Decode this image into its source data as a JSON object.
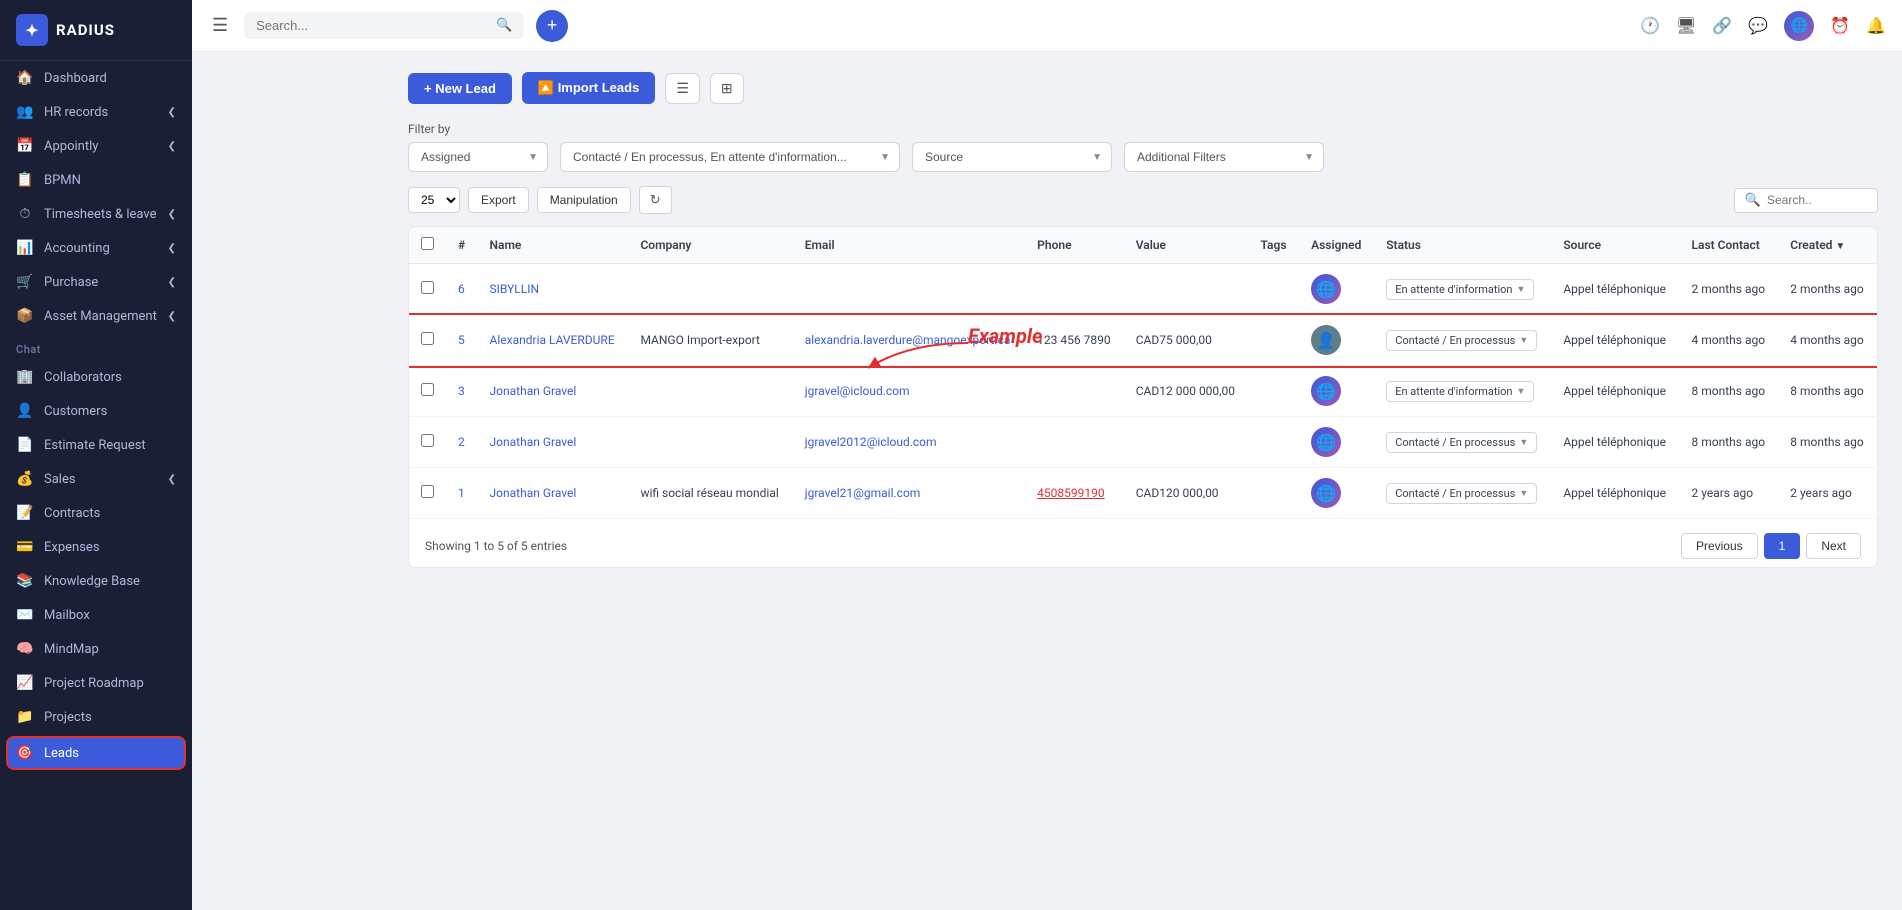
{
  "app": {
    "name": "RADIUS"
  },
  "sidebar": {
    "items": [
      {
        "id": "dashboard",
        "label": "Dashboard",
        "icon": "🏠"
      },
      {
        "id": "hr-records",
        "label": "HR records",
        "icon": "👥",
        "hasChevron": true
      },
      {
        "id": "appointly",
        "label": "Appointly",
        "icon": "📅",
        "hasChevron": true
      },
      {
        "id": "bpmn",
        "label": "BPMN",
        "icon": "📋"
      },
      {
        "id": "timesheets",
        "label": "Timesheets & leave",
        "icon": "⏱",
        "hasChevron": true
      },
      {
        "id": "accounting",
        "label": "Accounting",
        "icon": "📊",
        "hasChevron": true
      },
      {
        "id": "purchase",
        "label": "Purchase",
        "icon": "🛒",
        "hasChevron": true
      },
      {
        "id": "asset-management",
        "label": "Asset Management",
        "icon": "📦",
        "hasChevron": true
      },
      {
        "id": "chat",
        "label": "Chat",
        "isSection": true
      },
      {
        "id": "collaborators",
        "label": "Collaborators",
        "icon": "🏢"
      },
      {
        "id": "customers",
        "label": "Customers",
        "icon": "👤"
      },
      {
        "id": "estimate-request",
        "label": "Estimate Request",
        "icon": "📄"
      },
      {
        "id": "sales",
        "label": "Sales",
        "icon": "💰",
        "hasChevron": true
      },
      {
        "id": "contracts",
        "label": "Contracts",
        "icon": "📝"
      },
      {
        "id": "expenses",
        "label": "Expenses",
        "icon": "💳"
      },
      {
        "id": "knowledge-base",
        "label": "Knowledge Base",
        "icon": "📚"
      },
      {
        "id": "mailbox",
        "label": "Mailbox",
        "icon": "✉️"
      },
      {
        "id": "mindmap",
        "label": "MindMap",
        "icon": "🧠"
      },
      {
        "id": "project-roadmap",
        "label": "Project Roadmap",
        "icon": "📈"
      },
      {
        "id": "projects",
        "label": "Projects",
        "icon": "📁"
      },
      {
        "id": "leads",
        "label": "Leads",
        "icon": "🎯",
        "isActive": true
      }
    ]
  },
  "topbar": {
    "search_placeholder": "Search...",
    "search_label": "Search .",
    "icons": [
      "history",
      "screen",
      "share",
      "chat",
      "globe",
      "clock",
      "bell"
    ]
  },
  "toolbar": {
    "new_lead_label": "+ New Lead",
    "import_leads_label": "🔼 Import Leads"
  },
  "filters": {
    "label": "Filter by",
    "assigned_placeholder": "Assigned",
    "status_value": "Contacté / En processus, En attente d'information...",
    "source_placeholder": "Source",
    "additional_placeholder": "Additional Filters"
  },
  "table_controls": {
    "per_page": "25",
    "export_label": "Export",
    "manipulation_label": "Manipulation",
    "search_placeholder": "Search.."
  },
  "table": {
    "columns": [
      "",
      "#",
      "Name",
      "Company",
      "Email",
      "Phone",
      "Value",
      "Tags",
      "Assigned",
      "Status",
      "Source",
      "Last Contact",
      "Created"
    ],
    "rows": [
      {
        "id": "6",
        "name": "SIBYLLIN",
        "company": "",
        "email": "",
        "phone": "",
        "value": "",
        "tags": "",
        "assigned_avatar": "🌐",
        "status": "En attente d'information",
        "source": "Appel téléphonique",
        "last_contact": "2 months ago",
        "created": "2 months ago",
        "highlighted": false
      },
      {
        "id": "5",
        "name": "Alexandria LAVERDURE",
        "company": "MANGO Import-export",
        "email": "alexandria.laverdure@mangoexport.ca",
        "phone": "123 456 7890",
        "value": "CAD75 000,00",
        "tags": "",
        "assigned_avatar": "👤",
        "status": "Contacté / En processus",
        "source": "Appel téléphonique",
        "last_contact": "4 months ago",
        "created": "4 months ago",
        "highlighted": true
      },
      {
        "id": "3",
        "name": "Jonathan Gravel",
        "company": "",
        "email": "jgravel@icloud.com",
        "phone": "",
        "value": "CAD12 000 000,00",
        "tags": "",
        "assigned_avatar": "🌐",
        "status": "En attente d'information",
        "source": "Appel téléphonique",
        "last_contact": "8 months ago",
        "created": "8 months ago",
        "highlighted": false
      },
      {
        "id": "2",
        "name": "Jonathan Gravel",
        "company": "",
        "email": "jgravel2012@icloud.com",
        "phone": "",
        "value": "",
        "tags": "",
        "assigned_avatar": "🌐",
        "status": "Contacté / En processus",
        "source": "Appel téléphonique",
        "last_contact": "8 months ago",
        "created": "8 months ago",
        "highlighted": false
      },
      {
        "id": "1",
        "name": "Jonathan Gravel",
        "company": "wifi social réseau mondial",
        "email": "jgravel21@gmail.com",
        "phone": "4508599190",
        "phone_red": true,
        "value": "CAD120 000,00",
        "tags": "",
        "assigned_avatar": "🌐",
        "status": "Contacté / En processus",
        "source": "Appel téléphonique",
        "last_contact": "2 years ago",
        "created": "2 years ago",
        "highlighted": false
      }
    ]
  },
  "pagination": {
    "showing_text": "Showing 1 to 5 of 5 entries",
    "previous_label": "Previous",
    "next_label": "Next",
    "current_page": "1"
  },
  "example_annotation": "Example"
}
